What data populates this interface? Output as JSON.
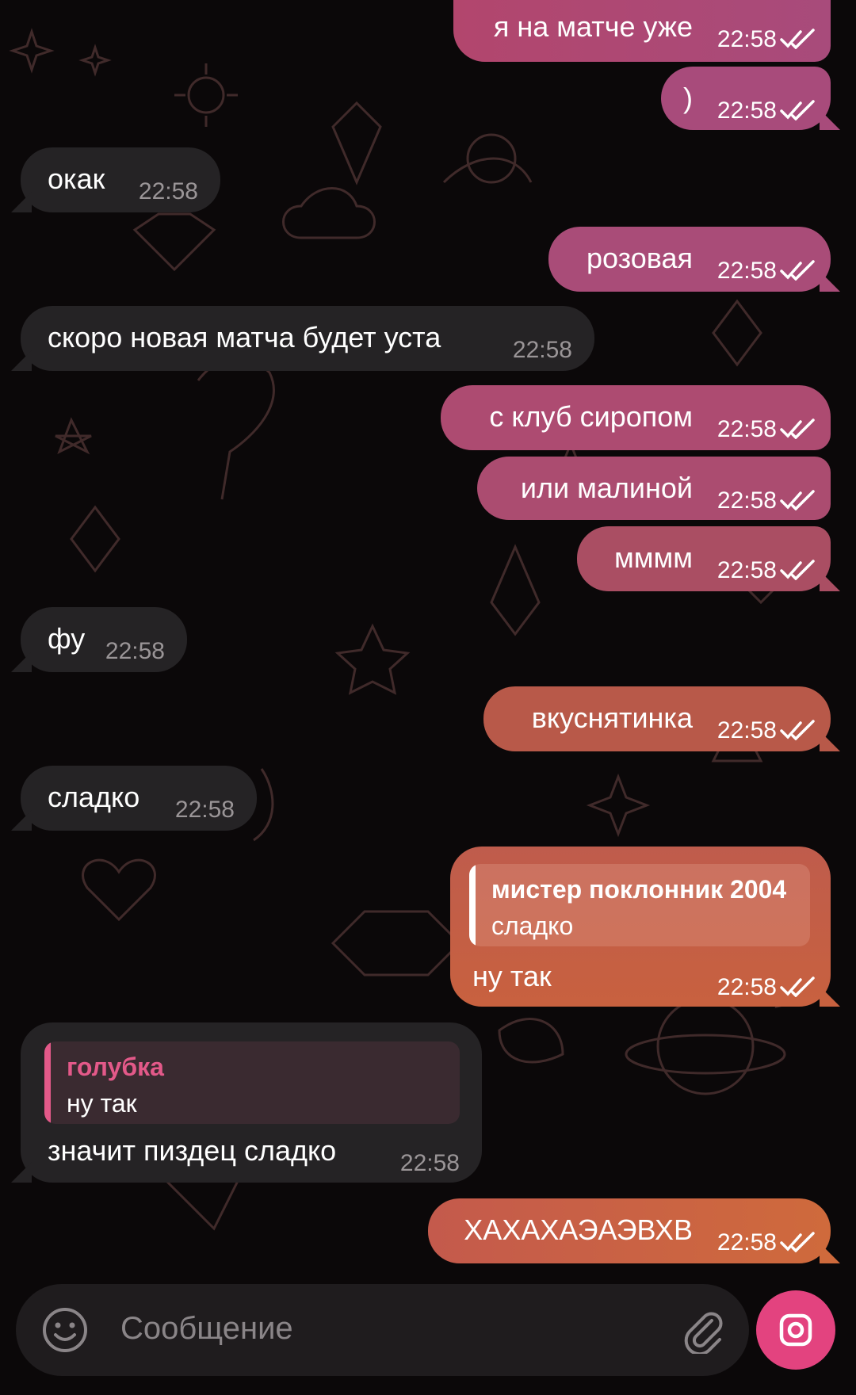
{
  "colors": {
    "background": "#0b0809",
    "incoming_bubble": "#252325",
    "outgoing_pink": "#b04b7c",
    "outgoing_orange": "#cf6a3c",
    "reply_accent_incoming": "#e35989",
    "time_incoming": "#9a9597",
    "send_button": "#e3437f"
  },
  "messages": [
    {
      "text": "я на матче уже",
      "time": "22:58"
    },
    {
      "text": ")",
      "time": "22:58"
    },
    {
      "text": "окак",
      "time": "22:58"
    },
    {
      "text": "розовая",
      "time": "22:58"
    },
    {
      "text": "скоро новая матча будет уста",
      "time": "22:58"
    },
    {
      "text": "с клуб сиропом",
      "time": "22:58"
    },
    {
      "text": "или малиной",
      "time": "22:58"
    },
    {
      "text": "мммм",
      "time": "22:58"
    },
    {
      "text": "фу",
      "time": "22:58"
    },
    {
      "text": "вкуснятинка",
      "time": "22:58"
    },
    {
      "text": "сладко",
      "time": "22:58"
    },
    {
      "text": "ну так",
      "time": "22:58",
      "reply_name": "мистер поклонник 2004",
      "reply_text": "сладко"
    },
    {
      "text": "значит пиздец сладко",
      "time": "22:58",
      "reply_name": "голубка",
      "reply_text": "ну так"
    },
    {
      "text": "ХАХАХАЭАЭВХВ",
      "time": "22:58"
    }
  ],
  "input": {
    "placeholder": "Сообщение"
  },
  "icons": {
    "emoji": "smile-icon",
    "attach": "paperclip-icon",
    "camera": "camera-icon",
    "read_status": "double-check-icon"
  }
}
